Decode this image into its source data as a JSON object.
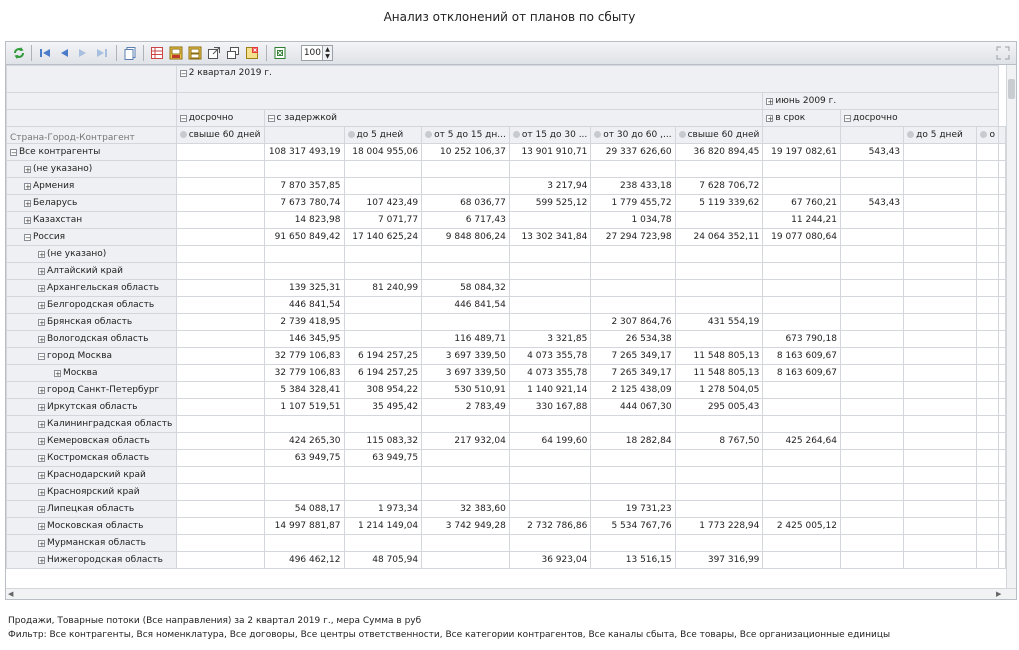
{
  "title": "Анализ отклонений от планов по сбыту",
  "toolbar": {
    "icons": [
      "refresh-icon",
      "first-page-icon",
      "prev-page-icon",
      "next-page-icon",
      "last-page-icon",
      "copy-icon",
      "grid-settings-icon",
      "export-icon",
      "print-icon",
      "open-window-icon",
      "windows-icon",
      "close-report-icon",
      "excel-icon"
    ],
    "zoom": "100"
  },
  "headers": {
    "corner": "Страна-Город-Контрагент",
    "period1": "2 квартал 2019 г.",
    "period2": "июнь 2009 г.",
    "early": "досрочно",
    "delayed": "с задержкой",
    "on_time": "в срок",
    "early2": "досрочно",
    "cols": [
      "свыше 60 дней",
      "",
      "до 5 дней",
      "от 5 до 15 дн...",
      "от 15 до 30 ...",
      "от 30 до 60 ,...",
      "свыше 60 дней",
      "",
      "",
      "до 5 дней",
      "о"
    ]
  },
  "rows": [
    {
      "label": "Все контрагенты",
      "level": 0,
      "sign": "−",
      "v": [
        "",
        "108 317 493,19",
        "18 004 955,06",
        "10 252 106,37",
        "13 901 910,71",
        "29 337 626,60",
        "36 820 894,45",
        "19 197 082,61",
        "543,43",
        "",
        ""
      ]
    },
    {
      "label": "(не указано)",
      "level": 1,
      "sign": "+",
      "v": [
        "",
        "",
        "",
        "",
        "",
        "",
        "",
        "",
        "",
        "",
        ""
      ]
    },
    {
      "label": "Армения",
      "level": 1,
      "sign": "+",
      "v": [
        "",
        "7 870 357,85",
        "",
        "",
        "3 217,94",
        "238 433,18",
        "7 628 706,72",
        "",
        "",
        "",
        ""
      ]
    },
    {
      "label": "Беларусь",
      "level": 1,
      "sign": "+",
      "v": [
        "",
        "7 673 780,74",
        "107 423,49",
        "68 036,77",
        "599 525,12",
        "1 779 455,72",
        "5 119 339,62",
        "67 760,21",
        "543,43",
        "",
        ""
      ]
    },
    {
      "label": "Казахстан",
      "level": 1,
      "sign": "+",
      "v": [
        "",
        "14 823,98",
        "7 071,77",
        "6 717,43",
        "",
        "1 034,78",
        "",
        "11 244,21",
        "",
        "",
        ""
      ]
    },
    {
      "label": "Россия",
      "level": 1,
      "sign": "−",
      "v": [
        "",
        "91 650 849,42",
        "17 140 625,24",
        "9 848 806,24",
        "13 302 341,84",
        "27 294 723,98",
        "24 064 352,11",
        "19 077 080,64",
        "",
        "",
        ""
      ]
    },
    {
      "label": "(не указано)",
      "level": 2,
      "sign": "+",
      "v": [
        "",
        "",
        "",
        "",
        "",
        "",
        "",
        "",
        "",
        "",
        ""
      ]
    },
    {
      "label": "Алтайский край",
      "level": 2,
      "sign": "+",
      "v": [
        "",
        "",
        "",
        "",
        "",
        "",
        "",
        "",
        "",
        "",
        ""
      ]
    },
    {
      "label": "Архангельская область",
      "level": 2,
      "sign": "+",
      "v": [
        "",
        "139 325,31",
        "81 240,99",
        "58 084,32",
        "",
        "",
        "",
        "",
        "",
        "",
        ""
      ]
    },
    {
      "label": "Белгородская область",
      "level": 2,
      "sign": "+",
      "v": [
        "",
        "446 841,54",
        "",
        "446 841,54",
        "",
        "",
        "",
        "",
        "",
        "",
        ""
      ]
    },
    {
      "label": "Брянская область",
      "level": 2,
      "sign": "+",
      "v": [
        "",
        "2 739 418,95",
        "",
        "",
        "",
        "2 307 864,76",
        "431 554,19",
        "",
        "",
        "",
        ""
      ]
    },
    {
      "label": "Вологодская область",
      "level": 2,
      "sign": "+",
      "v": [
        "",
        "146 345,95",
        "",
        "116 489,71",
        "3 321,85",
        "26 534,38",
        "",
        "673 790,18",
        "",
        "",
        ""
      ]
    },
    {
      "label": "город Москва",
      "level": 2,
      "sign": "−",
      "v": [
        "",
        "32 779 106,83",
        "6 194 257,25",
        "3 697 339,50",
        "4 073 355,78",
        "7 265 349,17",
        "11 548 805,13",
        "8 163 609,67",
        "",
        "",
        ""
      ]
    },
    {
      "label": "Москва",
      "level": 3,
      "sign": "+",
      "v": [
        "",
        "32 779 106,83",
        "6 194 257,25",
        "3 697 339,50",
        "4 073 355,78",
        "7 265 349,17",
        "11 548 805,13",
        "8 163 609,67",
        "",
        "",
        ""
      ]
    },
    {
      "label": "город Санкт-Петербург",
      "level": 2,
      "sign": "+",
      "v": [
        "",
        "5 384 328,41",
        "308 954,22",
        "530 510,91",
        "1 140 921,14",
        "2 125 438,09",
        "1 278 504,05",
        "",
        "",
        "",
        ""
      ]
    },
    {
      "label": "Иркутская область",
      "level": 2,
      "sign": "+",
      "v": [
        "",
        "1 107 519,51",
        "35 495,42",
        "2 783,49",
        "330 167,88",
        "444 067,30",
        "295 005,43",
        "",
        "",
        "",
        ""
      ]
    },
    {
      "label": "Калининградская область",
      "level": 2,
      "sign": "+",
      "v": [
        "",
        "",
        "",
        "",
        "",
        "",
        "",
        "",
        "",
        "",
        ""
      ]
    },
    {
      "label": "Кемеровская область",
      "level": 2,
      "sign": "+",
      "v": [
        "",
        "424 265,30",
        "115 083,32",
        "217 932,04",
        "64 199,60",
        "18 282,84",
        "8 767,50",
        "425 264,64",
        "",
        "",
        ""
      ]
    },
    {
      "label": "Костромская область",
      "level": 2,
      "sign": "+",
      "v": [
        "",
        "63 949,75",
        "63 949,75",
        "",
        "",
        "",
        "",
        "",
        "",
        "",
        ""
      ]
    },
    {
      "label": "Краснодарский край",
      "level": 2,
      "sign": "+",
      "v": [
        "",
        "",
        "",
        "",
        "",
        "",
        "",
        "",
        "",
        "",
        ""
      ]
    },
    {
      "label": "Красноярский край",
      "level": 2,
      "sign": "+",
      "v": [
        "",
        "",
        "",
        "",
        "",
        "",
        "",
        "",
        "",
        "",
        ""
      ]
    },
    {
      "label": "Липецкая область",
      "level": 2,
      "sign": "+",
      "v": [
        "",
        "54 088,17",
        "1 973,34",
        "32 383,60",
        "",
        "19 731,23",
        "",
        "",
        "",
        "",
        ""
      ]
    },
    {
      "label": "Московская область",
      "level": 2,
      "sign": "+",
      "v": [
        "",
        "14 997 881,87",
        "1 214 149,04",
        "3 742 949,28",
        "2 732 786,86",
        "5 534 767,76",
        "1 773 228,94",
        "2 425 005,12",
        "",
        "",
        ""
      ]
    },
    {
      "label": "Мурманская область",
      "level": 2,
      "sign": "+",
      "v": [
        "",
        "",
        "",
        "",
        "",
        "",
        "",
        "",
        "",
        "",
        ""
      ]
    },
    {
      "label": "Нижегородская область",
      "level": 2,
      "sign": "+",
      "v": [
        "",
        "496 462,12",
        "48 705,94",
        "",
        "36 923,04",
        "13 516,15",
        "397 316,99",
        "",
        "",
        "",
        ""
      ]
    }
  ],
  "footer": {
    "line1": "Продажи, Товарные потоки (Все направления) за 2 квартал 2019 г., мера Сумма в руб",
    "line2": "Фильтр: Все контрагенты, Вся номенклатура, Все договоры, Все центры ответственности, Все категории контрагентов, Все каналы сбыта, Все товары, Все организационные единицы"
  }
}
